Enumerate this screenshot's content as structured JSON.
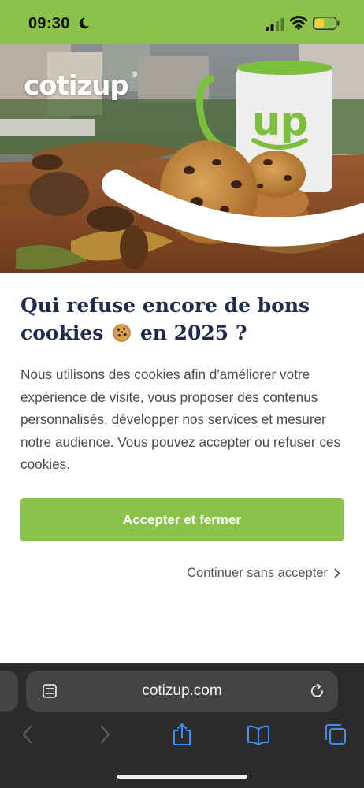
{
  "status_bar": {
    "time": "09:30",
    "icons": [
      "moon-icon",
      "signal-icon",
      "wifi-icon",
      "battery-icon"
    ],
    "background_color": "#8bc34a"
  },
  "hero": {
    "logo_text": "cotizup",
    "logo_registered": "®",
    "mug_text": "up"
  },
  "consent": {
    "title_part1": "Qui refuse encore de bons cookies",
    "title_part2": "en 2025 ?",
    "body": "Nous utilisons des cookies afin d'améliorer votre expérience de visite, vous proposer des contenus personnalisés, développer nos services et mesurer notre audience. Vous pouvez accepter ou refuser ces cookies.",
    "accept_label": "Accepter et fermer",
    "continue_label": "Continuer sans accepter",
    "accent_color": "#8bc34a",
    "title_color": "#1f2c4c"
  },
  "browser": {
    "url": "cotizup.com",
    "toolbar_icons": [
      "back-icon",
      "forward-icon",
      "share-icon",
      "bookmarks-icon",
      "tabs-icon"
    ]
  }
}
